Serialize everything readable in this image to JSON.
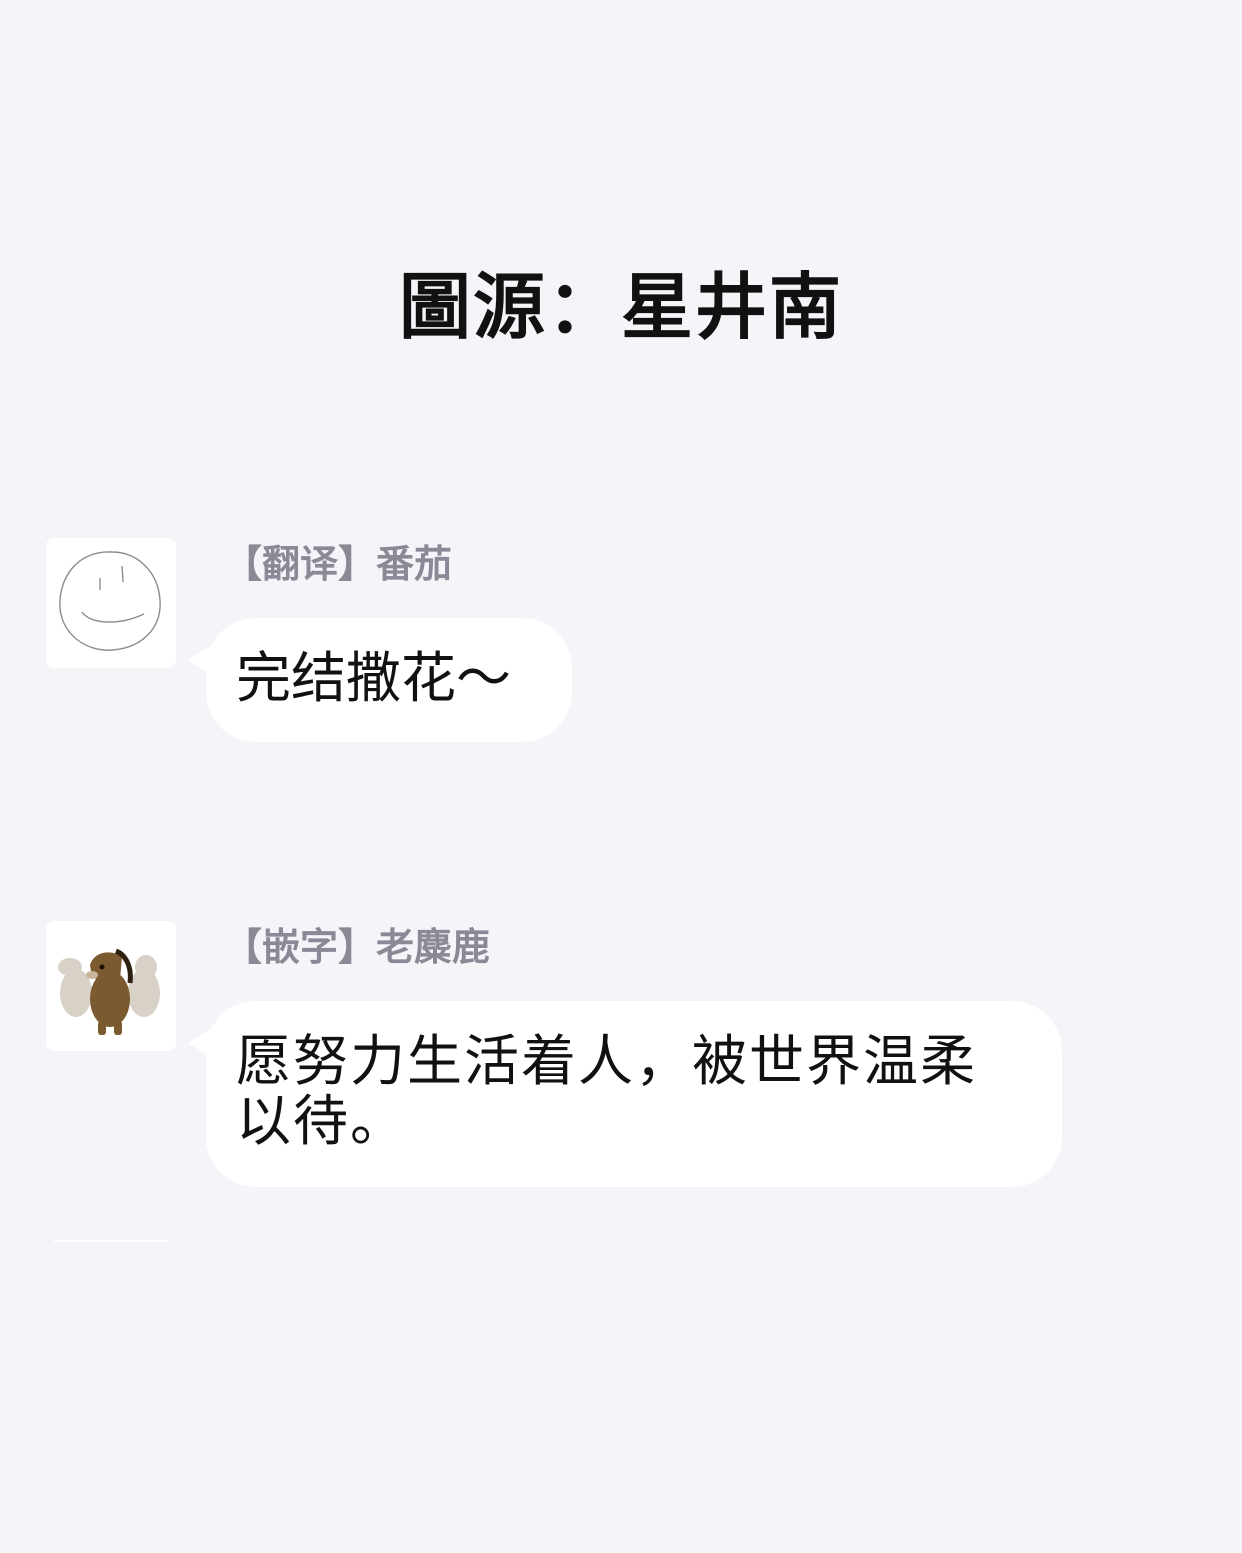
{
  "title": "圖源：星井南",
  "messages": [
    {
      "sender": "【翻译】番茄",
      "avatar_icon": "smiley-face-sketch-icon",
      "text": "完结撒花～"
    },
    {
      "sender": "【嵌字】老麋鹿",
      "avatar_icon": "horse-plush-icon",
      "text": "愿努力生活着人，被世界温柔以待。"
    }
  ],
  "colors": {
    "background": "#f4f5f9",
    "bubble": "#ffffff",
    "sender_text": "#8a8a96",
    "message_text": "#111111"
  }
}
